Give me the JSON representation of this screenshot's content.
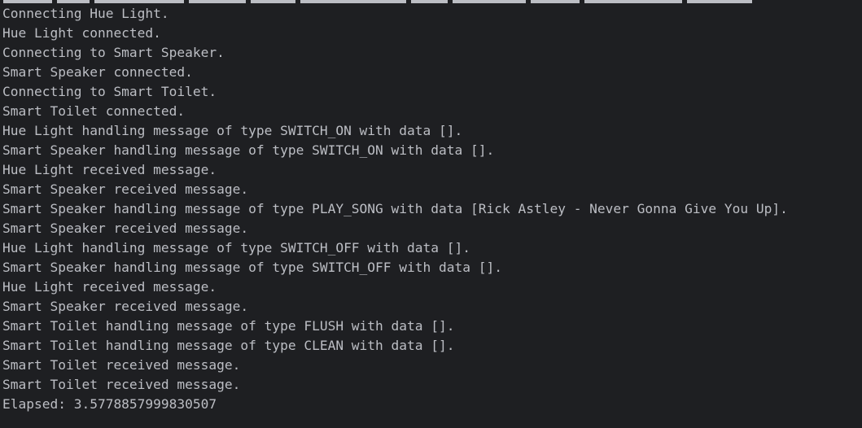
{
  "console": {
    "lines": [
      "Connecting Hue Light.",
      "Hue Light connected.",
      "Connecting to Smart Speaker.",
      "Smart Speaker connected.",
      "Connecting to Smart Toilet.",
      "Smart Toilet connected.",
      "Hue Light handling message of type SWITCH_ON with data [].",
      "Smart Speaker handling message of type SWITCH_ON with data [].",
      "Hue Light received message.",
      "Smart Speaker received message.",
      "Smart Speaker handling message of type PLAY_SONG with data [Rick Astley - Never Gonna Give You Up].",
      "Smart Speaker received message.",
      "Hue Light handling message of type SWITCH_OFF with data [].",
      "Smart Speaker handling message of type SWITCH_OFF with data [].",
      "Hue Light received message.",
      "Smart Speaker received message.",
      "Smart Toilet handling message of type FLUSH with data [].",
      "Smart Toilet handling message of type CLEAN with data [].",
      "Smart Toilet received message.",
      "Smart Toilet received message.",
      "Elapsed: 3.5778857999830507"
    ]
  }
}
